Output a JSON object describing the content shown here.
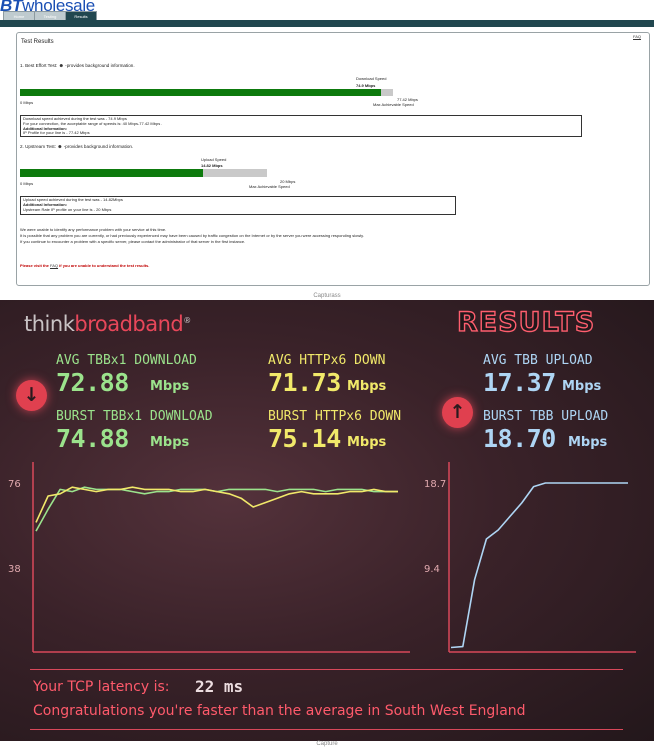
{
  "bt": {
    "logo_bt": "BT",
    "logo_text": "wholesale",
    "tabs": [
      "Home",
      "Testing",
      "Results"
    ],
    "faq_link": "FAQ",
    "panel_title": "Test Results",
    "best_effort": {
      "heading_prefix": "1. Best Effort Test: ",
      "heading_suffix": " -provides background information.",
      "caption_label": "Download Speed",
      "caption_value": "74.9 Mbps",
      "left_label": "0 Mbps",
      "right_value": "77.42 Mbps",
      "right_label": "Max Achievable Speed",
      "fill_fraction": 0.967,
      "info_lines": [
        "Download speed achieved during the test was - 74.9 Mbps",
        "For your connection, the acceptable range of speeds is: 40 Mbps-77.42 Mbps .",
        "Additional Information:",
        "IP Profile for your line is - 77.42 Mbps"
      ]
    },
    "upstream": {
      "heading_prefix": "2. Upstream Test: ",
      "heading_suffix": " -provides background information.",
      "caption_label": "Upload Speed",
      "caption_value": "14.82 Mbps",
      "left_label": "0 Mbps",
      "right_value": "20 Mbps",
      "right_label": "Max Achievable Speed",
      "fill_fraction": 0.741,
      "info_lines": [
        "Upload speed achieved during the test was - 14.82Mbps",
        "Additional Information:",
        "Upstream Rate IP profile on your line is - 20 Mbps"
      ]
    },
    "message_lines": [
      "We were unable to identify any performance problem with your service at this time.",
      "It is possible that any problem you are currently, or had previously experienced may have been caused by traffic congestion on the Internet or by the server you were accessing responding slowly.",
      "If you continue to encounter a problem with a specific server, please contact the administrator of that server in the first instance."
    ],
    "faq_note_prefix": "Please visit the ",
    "faq_note_link": "FAQ",
    "faq_note_suffix": " if you are unable to understand the test results."
  },
  "caption1": "Capturass",
  "caption2": "Capture",
  "tbb": {
    "logo_think": "think",
    "logo_broadband": "broadband",
    "logo_reg": "®",
    "results_title": "RESULTS",
    "avg_tbb_download_label": "AVG TBBx1 DOWNLOAD",
    "avg_tbb_download_value": "72.88",
    "burst_tbb_download_label": "BURST TBBx1 DOWNLOAD",
    "burst_tbb_download_value": "74.88",
    "avg_http_down_label": "AVG HTTPx6 DOWN",
    "avg_http_down_value": "71.73",
    "burst_http_down_label": "BURST HTTPx6 DOWN",
    "burst_http_down_value": "75.14",
    "avg_upload_label": "AVG TBB UPLOAD",
    "avg_upload_value": "17.37",
    "burst_upload_label": "BURST TBB UPLOAD",
    "burst_upload_value": "18.70",
    "unit": "Mbps",
    "download_axis_max": "76",
    "download_axis_mid": "38",
    "upload_axis_max": "18.7",
    "upload_axis_mid": "9.4",
    "latency_label": "Your TCP latency is:",
    "latency_value": "22 ms",
    "congrats": "Congratulations you're faster than the average in South West England",
    "colors": {
      "green": "#9be38c",
      "yellow": "#f1e96a",
      "blue": "#aed5f4",
      "accent": "#e0404f"
    }
  },
  "chart_data": [
    {
      "type": "line",
      "title": "",
      "xlabel": "",
      "ylabel": "",
      "ylim": [
        0,
        76
      ],
      "y_ticks": [
        38,
        76
      ],
      "grid": false,
      "series": [
        {
          "values": [
            55,
            65,
            74,
            73,
            75,
            74,
            74,
            74,
            73,
            72,
            73,
            73,
            74,
            74,
            74,
            73,
            74,
            74,
            74,
            74,
            73,
            74,
            74,
            74,
            73,
            74,
            74,
            74,
            73,
            73,
            73
          ]
        },
        {
          "values": [
            59,
            71,
            72,
            75,
            74,
            73,
            74,
            74,
            75,
            74,
            74,
            74,
            73,
            73,
            74,
            73,
            72,
            70,
            66,
            68,
            70,
            72,
            73,
            72,
            72,
            72,
            73,
            73,
            74,
            73,
            73
          ]
        }
      ]
    },
    {
      "type": "line",
      "title": "",
      "xlabel": "",
      "ylabel": "",
      "ylim": [
        0,
        18.7
      ],
      "y_ticks": [
        9.4,
        18.7
      ],
      "grid": false,
      "series": [
        {
          "values": [
            0.5,
            0.6,
            8,
            12.5,
            13.5,
            15,
            16.5,
            18.3,
            18.7,
            18.7,
            18.7,
            18.7,
            18.7,
            18.7,
            18.7,
            18.7
          ]
        }
      ]
    }
  ]
}
